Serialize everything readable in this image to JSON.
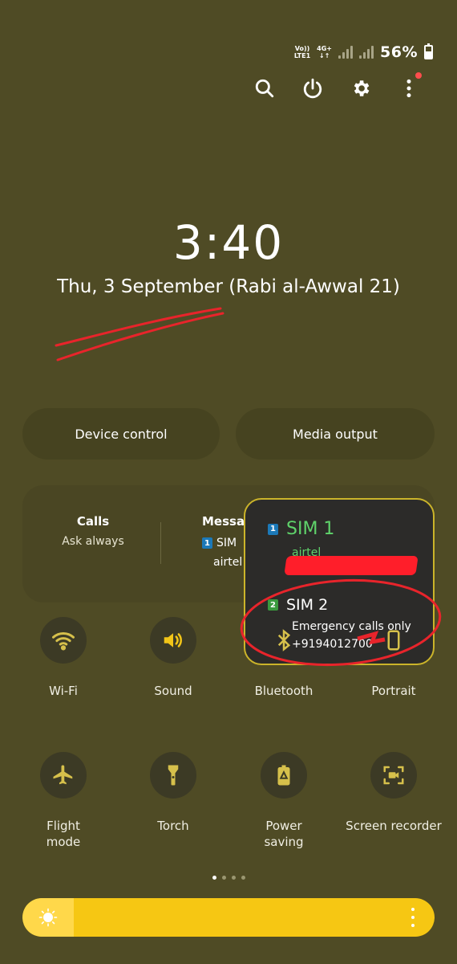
{
  "status": {
    "volte_line1": "Vo))",
    "volte_line2": "LTE1",
    "network": "4G+",
    "battery": "56%",
    "battery_level": 0.56
  },
  "header_actions": [
    {
      "icon": "search-icon"
    },
    {
      "icon": "power-icon"
    },
    {
      "icon": "gear-icon"
    },
    {
      "icon": "more-vertical-icon",
      "has_notification_dot": true
    }
  ],
  "clock": {
    "time": "3:40",
    "date": "Thu, 3 September (Rabi al-Awwal 21)"
  },
  "pills": {
    "device_control": "Device control",
    "media_output": "Media output"
  },
  "sim_panel": {
    "calls_title": "Calls",
    "calls_value": "Ask always",
    "messages_title": "Messag",
    "messages_sim_num": "1",
    "messages_sim": "SIM",
    "messages_carrier": "airtel"
  },
  "sim_popup": {
    "sim1_num": "1",
    "sim1_name": "SIM 1",
    "sim1_carrier": "airtel",
    "sim2_num": "2",
    "sim2_name": "SIM 2",
    "sim2_status": "Emergency calls only",
    "sim2_number": "+9194012700"
  },
  "tiles_row1": [
    {
      "label": "Wi-Fi",
      "icon": "wifi-icon"
    },
    {
      "label": "Sound",
      "icon": "speaker-icon"
    },
    {
      "label": "Bluetooth",
      "icon": "bluetooth-icon"
    },
    {
      "label": "Portrait",
      "icon": "portrait-icon"
    }
  ],
  "tiles_row2": [
    {
      "label": "Flight\nmode",
      "icon": "airplane-icon"
    },
    {
      "label": "Torch",
      "icon": "flashlight-icon"
    },
    {
      "label": "Power\nsaving",
      "icon": "battery-saver-icon"
    },
    {
      "label": "Screen recorder",
      "icon": "screen-recorder-icon"
    }
  ],
  "pager": {
    "pages": 4,
    "active": 0
  },
  "brightness": {
    "level": 0.12
  },
  "colors": {
    "background": "#4f4b25",
    "accent_yellow": "#f6c713",
    "sim_green": "#5fd36b",
    "annotation_red": "#ff1e2a"
  }
}
